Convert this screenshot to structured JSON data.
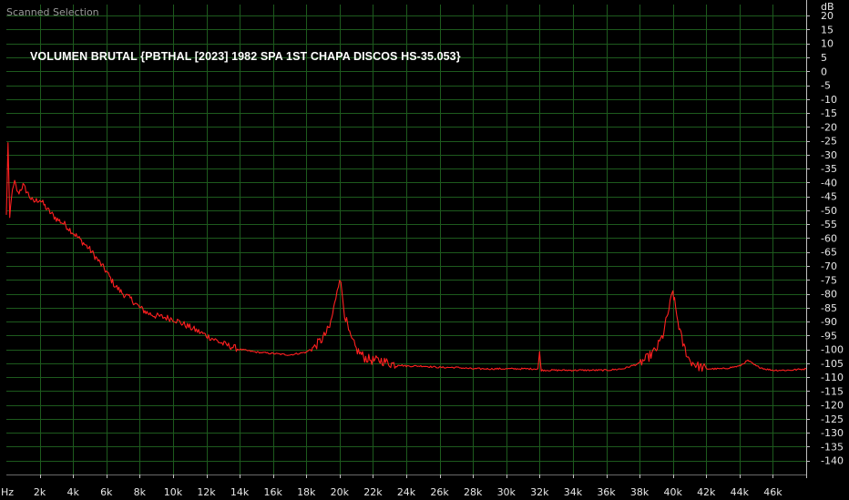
{
  "panel": {
    "label": "Scanned Selection"
  },
  "colors": {
    "background": "#000000",
    "grid": "#1d5a1d",
    "trace": "#ff2020",
    "trace_highlight": "#35d335",
    "axis_text": "#e6e6e6"
  },
  "chart_data": {
    "type": "line",
    "title": "VOLUMEN BRUTAL {PBTHAL [2023] 1982 SPA 1ST CHAPA DISCOS HS-35.053}",
    "xlabel": "Hz",
    "ylabel": "dB",
    "xlim": [
      0,
      48000
    ],
    "ylim": [
      -145,
      24
    ],
    "grid": true,
    "x_ticks": [
      {
        "value": 2000,
        "label": "2k"
      },
      {
        "value": 4000,
        "label": "4k"
      },
      {
        "value": 6000,
        "label": "6k"
      },
      {
        "value": 8000,
        "label": "8k"
      },
      {
        "value": 10000,
        "label": "10k"
      },
      {
        "value": 12000,
        "label": "12k"
      },
      {
        "value": 14000,
        "label": "14k"
      },
      {
        "value": 16000,
        "label": "16k"
      },
      {
        "value": 18000,
        "label": "18k"
      },
      {
        "value": 20000,
        "label": "20k"
      },
      {
        "value": 22000,
        "label": "22k"
      },
      {
        "value": 24000,
        "label": "24k"
      },
      {
        "value": 26000,
        "label": "26k"
      },
      {
        "value": 28000,
        "label": "28k"
      },
      {
        "value": 30000,
        "label": "30k"
      },
      {
        "value": 32000,
        "label": "32k"
      },
      {
        "value": 34000,
        "label": "34k"
      },
      {
        "value": 36000,
        "label": "36k"
      },
      {
        "value": 38000,
        "label": "38k"
      },
      {
        "value": 40000,
        "label": "40k"
      },
      {
        "value": 42000,
        "label": "42k"
      },
      {
        "value": 44000,
        "label": "44k"
      },
      {
        "value": 46000,
        "label": "46k"
      }
    ],
    "y_ticks": [
      {
        "value": 20,
        "label": "20"
      },
      {
        "value": 15,
        "label": "15"
      },
      {
        "value": 10,
        "label": "10"
      },
      {
        "value": 5,
        "label": "5"
      },
      {
        "value": 0,
        "label": "0"
      },
      {
        "value": -5,
        "label": "-5"
      },
      {
        "value": -10,
        "label": "-10"
      },
      {
        "value": -15,
        "label": "-15"
      },
      {
        "value": -20,
        "label": "-20"
      },
      {
        "value": -25,
        "label": "-25"
      },
      {
        "value": -30,
        "label": "-30"
      },
      {
        "value": -35,
        "label": "-35"
      },
      {
        "value": -40,
        "label": "-40"
      },
      {
        "value": -45,
        "label": "-45"
      },
      {
        "value": -50,
        "label": "-50"
      },
      {
        "value": -55,
        "label": "-55"
      },
      {
        "value": -60,
        "label": "-60"
      },
      {
        "value": -65,
        "label": "-65"
      },
      {
        "value": -70,
        "label": "-70"
      },
      {
        "value": -75,
        "label": "-75"
      },
      {
        "value": -80,
        "label": "-80"
      },
      {
        "value": -85,
        "label": "-85"
      },
      {
        "value": -90,
        "label": "-90"
      },
      {
        "value": -95,
        "label": "-95"
      },
      {
        "value": -100,
        "label": "-100"
      },
      {
        "value": -105,
        "label": "-105"
      },
      {
        "value": -110,
        "label": "-110"
      },
      {
        "value": -115,
        "label": "-115"
      },
      {
        "value": -120,
        "label": "-120"
      },
      {
        "value": -125,
        "label": "-125"
      },
      {
        "value": -130,
        "label": "-130"
      },
      {
        "value": -135,
        "label": "-135"
      },
      {
        "value": -140,
        "label": "-140"
      }
    ],
    "series": [
      {
        "color": "#ff2020",
        "x": [
          0,
          100,
          200,
          300,
          500,
          700,
          1000,
          1300,
          1600,
          2000,
          2500,
          3000,
          3500,
          4000,
          4500,
          5000,
          5500,
          6000,
          6500,
          7000,
          7500,
          8000,
          8500,
          9000,
          10000,
          11000,
          12000,
          13000,
          14000,
          15000,
          16000,
          17000,
          18000,
          18500,
          19000,
          19400,
          19700,
          19850,
          20000,
          20150,
          20300,
          20600,
          21000,
          21500,
          22000,
          22500,
          23000,
          23500,
          24000,
          25000,
          26000,
          27000,
          28000,
          29000,
          30000,
          31000,
          31900,
          32000,
          32100,
          33000,
          34000,
          35000,
          36000,
          37000,
          38000,
          38500,
          39000,
          39400,
          39700,
          39900,
          40000,
          40100,
          40300,
          40600,
          41000,
          41500,
          42000,
          43000,
          44000,
          44500,
          45000,
          45500,
          46000,
          47000,
          48000
        ],
        "y": [
          -52,
          -26,
          -53,
          -45,
          -40,
          -44,
          -41,
          -44,
          -47,
          -46,
          -50,
          -53,
          -55,
          -58,
          -61,
          -64,
          -68,
          -72,
          -77,
          -80,
          -82,
          -85,
          -87,
          -88,
          -89,
          -92,
          -95,
          -98,
          -100,
          -101,
          -101.5,
          -102,
          -101,
          -99,
          -96,
          -92,
          -84,
          -78,
          -74,
          -80,
          -87,
          -95,
          -100,
          -103,
          -104,
          -104,
          -105,
          -105.5,
          -106,
          -106,
          -106.5,
          -106.5,
          -107,
          -107,
          -107,
          -107,
          -107,
          -101,
          -107.5,
          -107.5,
          -107.5,
          -107.5,
          -107.5,
          -107,
          -105,
          -103,
          -100,
          -95,
          -87,
          -82,
          -79,
          -83,
          -90,
          -98,
          -104,
          -106,
          -107,
          -107,
          -106,
          -104,
          -106,
          -107,
          -107.5,
          -107.5,
          -107
        ]
      }
    ]
  }
}
